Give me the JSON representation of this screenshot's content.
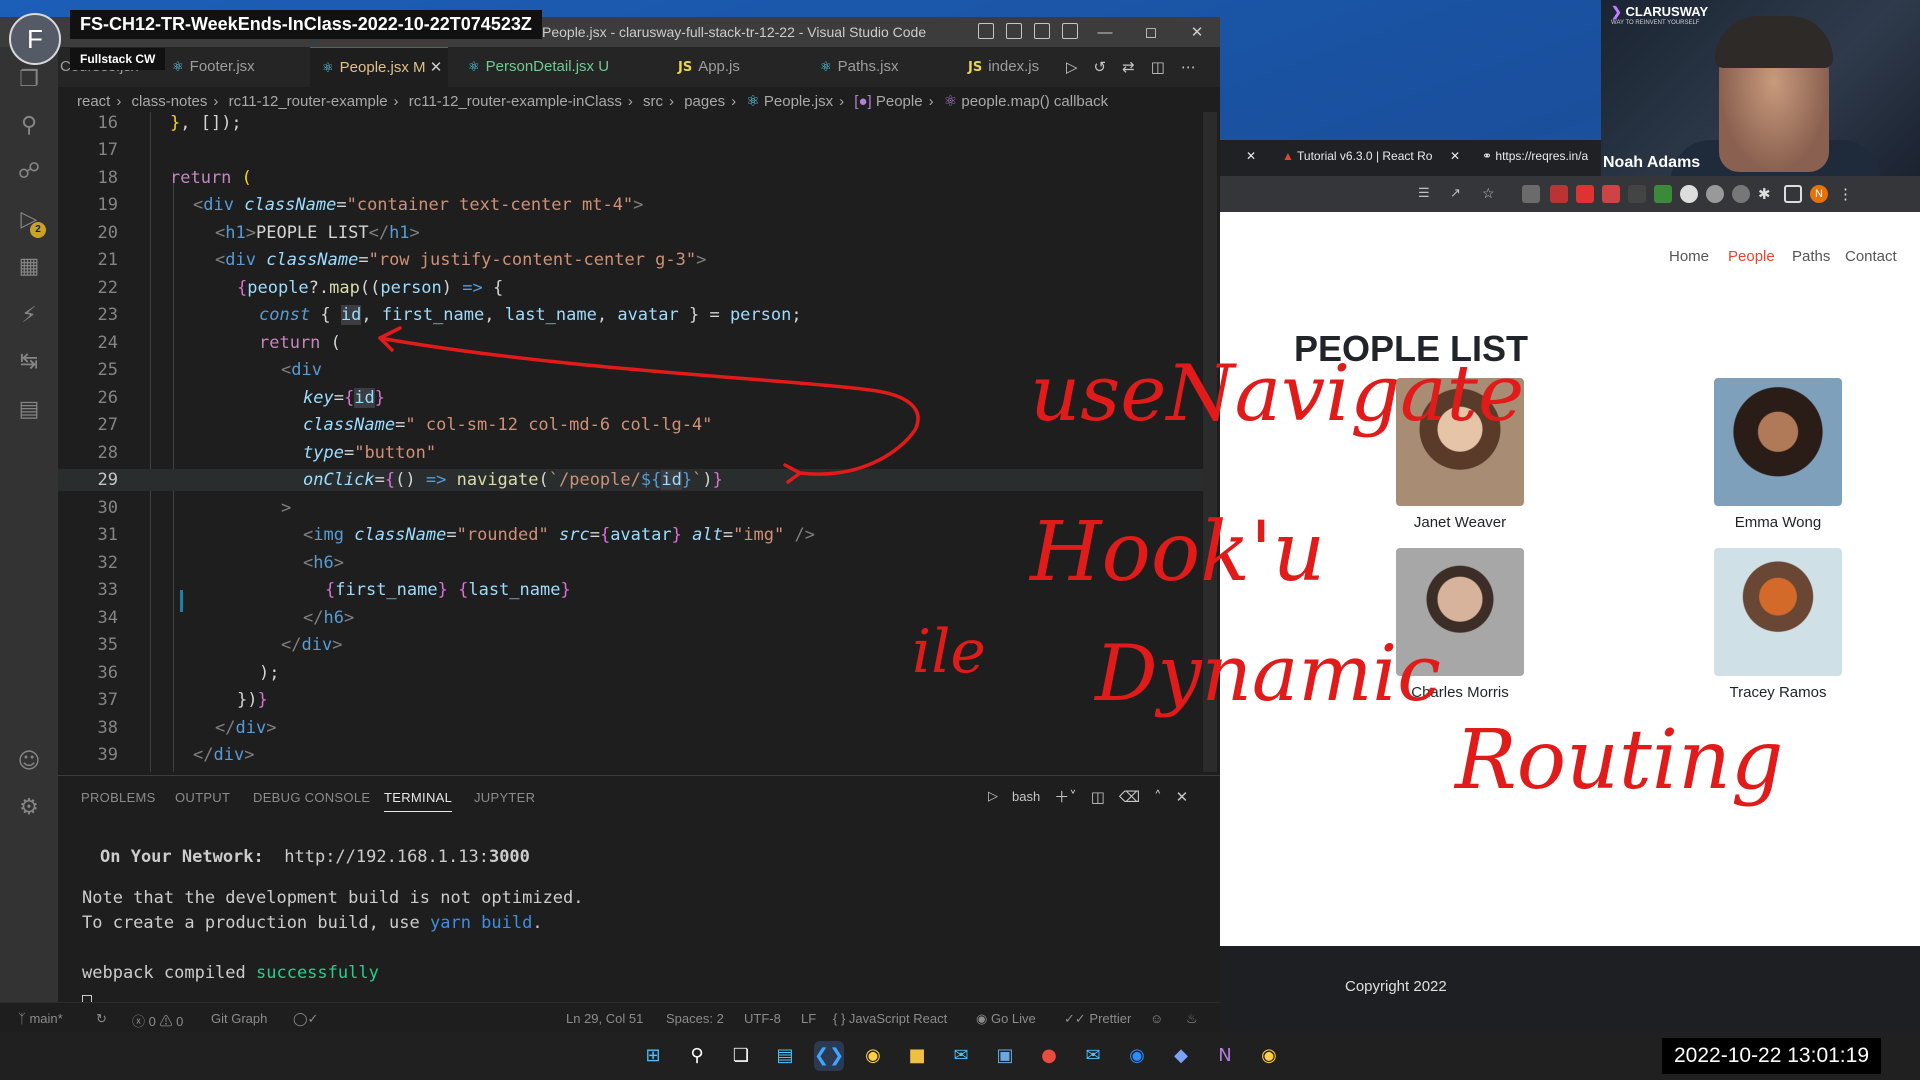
{
  "recording": {
    "avatar_letter": "F",
    "title": "FS-CH12-TR-WeekEnds-InClass-2022-10-22T074523Z",
    "subtitle": "Fullstack CW"
  },
  "vscode": {
    "window_title": "People.jsx - clarusway-full-stack-tr-12-22 - Visual Studio Code",
    "tabs": [
      {
        "label": "Courses.jsx",
        "marker": ""
      },
      {
        "label": "Footer.jsx",
        "marker": ""
      },
      {
        "label": "People.jsx",
        "marker": "M"
      },
      {
        "label": "PersonDetail.jsx",
        "marker": "U"
      },
      {
        "label": "App.js",
        "marker": ""
      },
      {
        "label": "Paths.jsx",
        "marker": ""
      },
      {
        "label": "index.js",
        "marker": ""
      }
    ],
    "breadcrumb": [
      "react",
      "class-notes",
      "rc11-12_router-example",
      "rc11-12_router-example-inClass",
      "src",
      "pages",
      "People.jsx",
      "People",
      "people.map() callback"
    ],
    "lines": [
      {
        "n": "16",
        "text": "}, []);"
      },
      {
        "n": "17",
        "text": ""
      },
      {
        "n": "18",
        "text": "return ("
      },
      {
        "n": "19",
        "text": "<div className=\"container text-center mt-4\">"
      },
      {
        "n": "20",
        "text": "<h1>PEOPLE LIST</h1>"
      },
      {
        "n": "21",
        "text": "<div className=\"row justify-content-center g-3\">"
      },
      {
        "n": "22",
        "text": "{people?.map((person) => {"
      },
      {
        "n": "23",
        "text": "const { id, first_name, last_name, avatar } = person;"
      },
      {
        "n": "24",
        "text": "return ("
      },
      {
        "n": "25",
        "text": "<div"
      },
      {
        "n": "26",
        "text": "key={id}"
      },
      {
        "n": "27",
        "text": "className=\" col-sm-12 col-md-6 col-lg-4\""
      },
      {
        "n": "28",
        "text": "type=\"button\""
      },
      {
        "n": "29",
        "text": "onClick={() => navigate(`/people/${id}`)}"
      },
      {
        "n": "30",
        "text": ">"
      },
      {
        "n": "31",
        "text": "<img className=\"rounded\" src={avatar} alt=\"img\" />"
      },
      {
        "n": "32",
        "text": "<h6>"
      },
      {
        "n": "33",
        "text": "{first_name} {last_name}"
      },
      {
        "n": "34",
        "text": "</h6>"
      },
      {
        "n": "35",
        "text": "</div>"
      },
      {
        "n": "36",
        "text": ");"
      },
      {
        "n": "37",
        "text": "})}"
      },
      {
        "n": "38",
        "text": "</div>"
      },
      {
        "n": "39",
        "text": "</div>"
      }
    ],
    "panel_tabs": [
      "PROBLEMS",
      "OUTPUT",
      "DEBUG CONSOLE",
      "TERMINAL",
      "JUPYTER"
    ],
    "active_panel_tab": "TERMINAL",
    "shell": "bash",
    "terminal": {
      "network_label": "On Your Network:",
      "network_url": "http://192.168.1.13:",
      "network_port": "3000",
      "note1": "Note that the development build is not optimized.",
      "note2_prefix": "To create a production build, use ",
      "note2_cmd": "yarn build",
      "note2_suffix": ".",
      "compiled_prefix": "webpack compiled ",
      "compiled_status": "successfully"
    },
    "status": {
      "branch": "main*",
      "problems": "ⓧ 0 ⚠ 0",
      "git_graph": "Git Graph",
      "position": "Ln 29, Col 51",
      "spaces": "Spaces: 2",
      "encoding": "UTF-8",
      "eol": "LF",
      "language": "JavaScript React",
      "golive": "Go Live",
      "prettier": "Prettier"
    },
    "activity_badge": "2"
  },
  "browser": {
    "tab1": "Tutorial v6.3.0 | React Ro",
    "tab2": "https://reqres.in/a",
    "profile_letter": "N",
    "nav": [
      {
        "label": "Home",
        "active": false
      },
      {
        "label": "People",
        "active": true
      },
      {
        "label": "Paths",
        "active": false
      },
      {
        "label": "Contact",
        "active": false
      }
    ],
    "page_title": "PEOPLE LIST",
    "people": [
      {
        "name": "Janet Weaver",
        "color": "#9c7b63"
      },
      {
        "name": "Emma Wong",
        "color": "#6f8fa8"
      },
      {
        "name": "Charles Morris",
        "color": "#9a9a9a"
      },
      {
        "name": "Tracey Ramos",
        "color": "#b9cfd8"
      }
    ],
    "footer": "Copyright 2022"
  },
  "webcam": {
    "brand": "CLARUSWAY",
    "tagline": "WAY TO REINVENT YOURSELF",
    "name": "Noah Adams"
  },
  "annotations": [
    "useNavigate",
    "Hook'u",
    "ile",
    "Dynamic",
    "Routing"
  ],
  "clock": "2022-10-22  13:01:19",
  "colors": {
    "accent": "#e6442f",
    "ink": "#e11a1a",
    "vscode_blue": "#0078d4"
  }
}
